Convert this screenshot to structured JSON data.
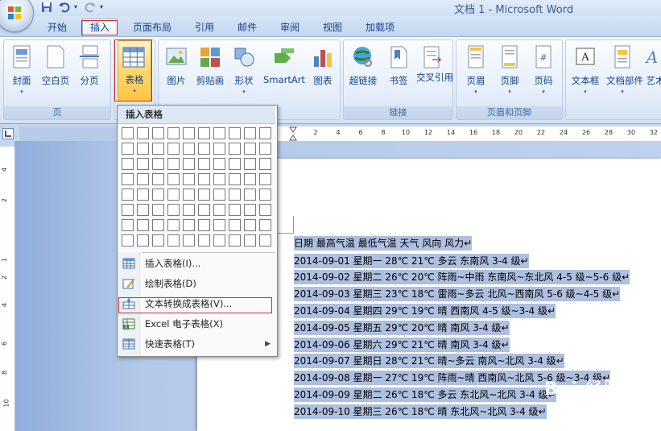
{
  "window": {
    "title": "文档 1 - Microsoft Word",
    "quick_access": [
      "save-icon",
      "undo-icon",
      "redo-icon"
    ]
  },
  "ribbon_tabs": [
    {
      "label": "开始"
    },
    {
      "label": "插入",
      "active": true
    },
    {
      "label": "页面布局"
    },
    {
      "label": "引用"
    },
    {
      "label": "邮件"
    },
    {
      "label": "审阅"
    },
    {
      "label": "视图"
    },
    {
      "label": "加载项"
    }
  ],
  "ribbon": {
    "groups": {
      "page": {
        "label": "页",
        "buttons": [
          "封面",
          "空白页",
          "分页"
        ]
      },
      "table": {
        "buttons": [
          "表格"
        ]
      },
      "illustrations": {
        "buttons": [
          "图片",
          "剪贴画",
          "形状",
          "SmartArt",
          "图表"
        ]
      },
      "links": {
        "label": "链接",
        "buttons": [
          "超链接",
          "书签",
          "交叉引用"
        ]
      },
      "header_footer": {
        "label": "页眉和页脚",
        "buttons": [
          "页眉",
          "页脚",
          "页码"
        ]
      },
      "text": {
        "buttons": [
          "文本框",
          "文档部件",
          "艺术"
        ]
      }
    }
  },
  "ruler": {
    "top_numbers": [
      "2",
      "4",
      "6",
      "8",
      "10",
      "12",
      "14",
      "16",
      "18",
      "20",
      "22",
      "24",
      "26",
      "28",
      "30",
      "32"
    ],
    "left_numbers": [
      "4",
      "2",
      "1",
      "2",
      "4",
      "6",
      "8",
      "10"
    ]
  },
  "insert_table_menu": {
    "header": "插入表格",
    "grid": {
      "columns": 10,
      "rows": 8
    },
    "items": [
      {
        "label": "插入表格(I)...",
        "icon": "insert-table-icon"
      },
      {
        "label": "绘制表格(D)",
        "icon": "draw-table-icon"
      },
      {
        "label": "文本转换成表格(V)...",
        "icon": "convert-text-icon",
        "highlighted": true
      },
      {
        "label": "Excel 电子表格(X)",
        "icon": "excel-icon"
      },
      {
        "label": "快速表格(T)",
        "icon": "quick-table-icon",
        "submenu": true
      }
    ]
  },
  "document_lines": [
    "日期 最高气温 最低气温 天气 风向 风力↵",
    "2014-09-01 星期一 28℃ 21℃ 多云 东南风 3-4 级↵",
    "2014-09-02 星期二 26℃ 20℃ 阵雨~中雨 东南风~东北风 4-5 级~5-6 级↵",
    "2014-09-03 星期三 23℃ 18℃ 雷雨~多云 北风~西南风 5-6 级~4-5 级↵",
    "2014-09-04 星期四 29℃ 19℃ 晴 西南风 4-5 级~3-4 级↵",
    "2014-09-05 星期五 29℃ 20℃ 晴 南风 3-4 级↵",
    "2014-09-06 星期六 29℃ 21℃ 晴 南风 3-4 级↵",
    "2014-09-07 星期日 28℃ 21℃ 晴~多云 南风~北风 3-4 级↵",
    "2014-09-08 星期一 27℃ 19℃ 阵雨~晴 西南风~北风 5-6 级~3-4 级↵",
    "2014-09-09 星期二 26℃ 18℃ 多云 东北风~北风 3-4 级↵",
    "2014-09-10 星期三 26℃ 18℃ 晴 东北风~北风 3-4 级↵"
  ],
  "watermark": {
    "text": "Bai 经验",
    "sub": "jingyan.baidu.com"
  }
}
